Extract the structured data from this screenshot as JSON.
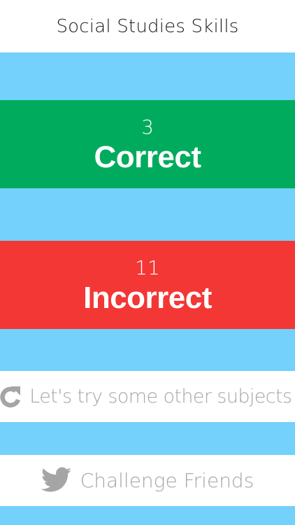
{
  "header": {
    "title": "Social Studies Skills"
  },
  "results": {
    "correct": {
      "count": "3",
      "label": "Correct",
      "color": "#01ab5e"
    },
    "incorrect": {
      "count": "11",
      "label": "Incorrect",
      "color": "#f33735"
    }
  },
  "actions": {
    "other_subjects": {
      "label": "Let's try some other subjects!",
      "icon": "refresh-icon"
    },
    "challenge": {
      "label": "Challenge Friends",
      "icon": "twitter-bird-icon"
    }
  },
  "colors": {
    "background": "#73d1fb",
    "panel": "#ffffff",
    "muted_text": "#a5a5a5"
  }
}
